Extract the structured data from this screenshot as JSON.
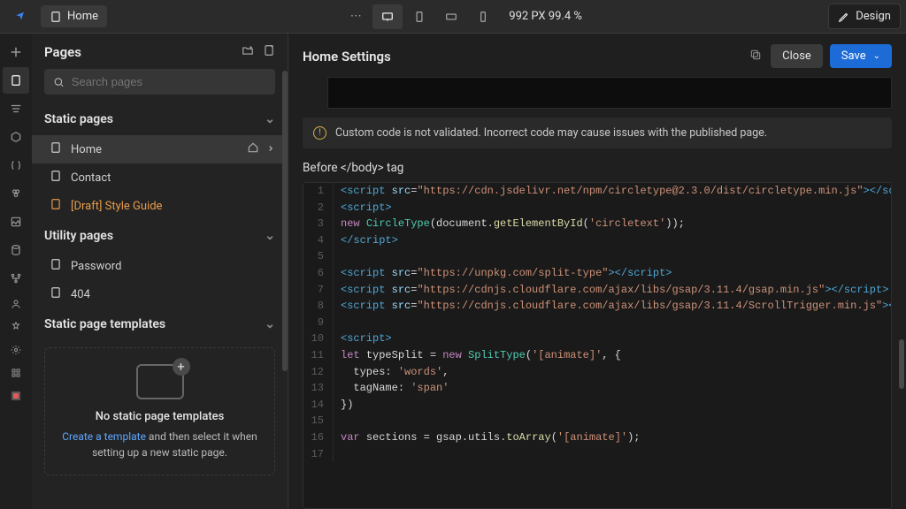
{
  "topbar": {
    "home_label": "Home",
    "viewport_text": "992 PX 99.4 %",
    "design_label": "Design"
  },
  "pages": {
    "title": "Pages",
    "search_placeholder": "Search pages",
    "static_section": "Static pages",
    "static_items": [
      {
        "label": "Home",
        "draft": false,
        "active": true
      },
      {
        "label": "Contact",
        "draft": false,
        "active": false
      },
      {
        "label": "[Draft] Style Guide",
        "draft": true,
        "active": false
      }
    ],
    "utility_section": "Utility pages",
    "utility_items": [
      {
        "label": "Password"
      },
      {
        "label": "404"
      }
    ],
    "templates_section": "Static page templates",
    "templates_empty_title": "No static page templates",
    "templates_link": "Create a template",
    "templates_rest": " and then select it when setting up a new static page."
  },
  "settings": {
    "title": "Home Settings",
    "close_label": "Close",
    "save_label": "Save",
    "warning": "Custom code is not validated. Incorrect code may cause issues with the published page.",
    "before_body_label": "Before </body> tag"
  },
  "code_lines": [
    {
      "n": "1",
      "html": "<span class='t'>&lt;script</span> <span class='a'>src</span>=<span class='s'>\"https://cdn.jsdelivr.net/npm/circletype@2.3.0/dist/circletype.min.js\"</span><span class='t'>&gt;&lt;/script&gt;</span>"
    },
    {
      "n": "2",
      "html": "<span class='t'>&lt;script&gt;</span>"
    },
    {
      "n": "3",
      "html": "<span class='k'>new</span> <span class='c'>CircleType</span>(<span class='p'>document</span>.<span class='n'>getElementById</span>(<span class='s'>'circletext'</span>));"
    },
    {
      "n": "4",
      "html": "<span class='t'>&lt;/script&gt;</span>"
    },
    {
      "n": "5",
      "html": ""
    },
    {
      "n": "6",
      "html": "<span class='t'>&lt;script</span> <span class='a'>src</span>=<span class='s'>\"https://unpkg.com/split-type\"</span><span class='t'>&gt;&lt;/script&gt;</span>"
    },
    {
      "n": "7",
      "html": "<span class='t'>&lt;script</span> <span class='a'>src</span>=<span class='s'>\"https://cdnjs.cloudflare.com/ajax/libs/gsap/3.11.4/gsap.min.js\"</span><span class='t'>&gt;&lt;/script&gt;</span>"
    },
    {
      "n": "8",
      "html": "<span class='t'>&lt;script</span> <span class='a'>src</span>=<span class='s'>\"https://cdnjs.cloudflare.com/ajax/libs/gsap/3.11.4/ScrollTrigger.min.js\"</span><span class='t'>&gt;&lt;/script&gt;</span>"
    },
    {
      "n": "9",
      "html": ""
    },
    {
      "n": "10",
      "html": "<span class='t'>&lt;script&gt;</span>"
    },
    {
      "n": "11",
      "html": "<span class='k'>let</span> <span class='p'>typeSplit</span> = <span class='k'>new</span> <span class='c'>SplitType</span>(<span class='s'>'[animate]'</span>, {"
    },
    {
      "n": "12",
      "html": "  <span class='p'>types</span>: <span class='s'>'words'</span>,"
    },
    {
      "n": "13",
      "html": "  <span class='p'>tagName</span>: <span class='s'>'span'</span>"
    },
    {
      "n": "14",
      "html": "})"
    },
    {
      "n": "15",
      "html": ""
    },
    {
      "n": "16",
      "html": "<span class='k'>var</span> <span class='p'>sections</span> = <span class='p'>gsap</span>.<span class='p'>utils</span>.<span class='n'>toArray</span>(<span class='s'>'[animate]'</span>);"
    },
    {
      "n": "17",
      "html": ""
    }
  ]
}
